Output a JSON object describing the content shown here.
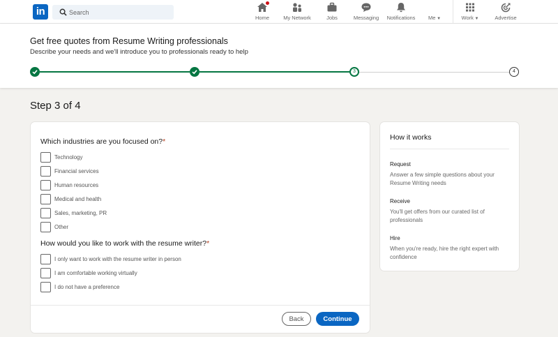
{
  "nav": {
    "logo": "in",
    "search_placeholder": "Search",
    "items": [
      {
        "label": "Home",
        "icon": "home-icon"
      },
      {
        "label": "My Network",
        "icon": "network-icon"
      },
      {
        "label": "Jobs",
        "icon": "briefcase-icon"
      },
      {
        "label": "Messaging",
        "icon": "messaging-icon"
      },
      {
        "label": "Notifications",
        "icon": "bell-icon"
      },
      {
        "label": "Me",
        "icon": "avatar-icon"
      },
      {
        "label": "Work",
        "icon": "grid-icon"
      },
      {
        "label": "Advertise",
        "icon": "advertise-icon"
      }
    ]
  },
  "header": {
    "title": "Get free quotes from Resume Writing professionals",
    "subtitle": "Describe your needs and we'll introduce you to professionals ready to help",
    "steps": [
      {
        "label": "",
        "state": "done"
      },
      {
        "label": "",
        "state": "done"
      },
      {
        "label": "3",
        "state": "current"
      },
      {
        "label": "4",
        "state": "future"
      }
    ]
  },
  "step_title": "Step 3 of 4",
  "form": {
    "q1": {
      "text": "Which industries are you focused on?",
      "required_mark": "*",
      "options": [
        "Technology",
        "Financial services",
        "Human resources",
        "Medical and health",
        "Sales, marketing, PR",
        "Other"
      ]
    },
    "q2": {
      "text": "How would you like to work with the resume writer?",
      "required_mark": "*",
      "options": [
        "I only want to work with the resume writer in person",
        "I am comfortable working virtually",
        "I do not have a preference"
      ]
    },
    "back_label": "Back",
    "continue_label": "Continue"
  },
  "how_it_works": {
    "title": "How it works",
    "items": [
      {
        "title": "Request",
        "desc": "Answer a few simple questions about your Resume Writing needs"
      },
      {
        "title": "Receive",
        "desc": "You'll get offers from our curated list of professionals"
      },
      {
        "title": "Hire",
        "desc": "When you're ready, hire the right expert with confidence"
      }
    ]
  },
  "colors": {
    "brand": "#0a66c2",
    "progress": "#057642",
    "notification_badge": "#cc1016"
  }
}
